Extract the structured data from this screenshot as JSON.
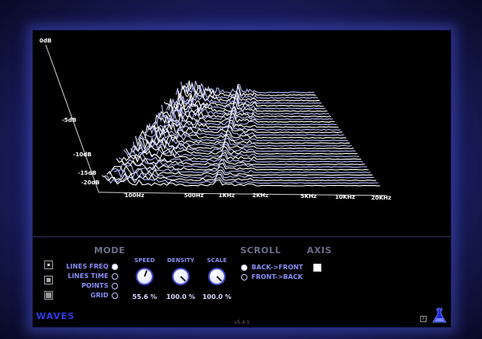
{
  "plot": {
    "y_labels": [
      "0dB",
      "-5dB",
      "-10dB",
      "-15dB",
      "-20dB"
    ],
    "x_labels": [
      "100Hz",
      "500Hz",
      "1KHz",
      "2KHz",
      "5KHz",
      "10KHz",
      "20KHz"
    ]
  },
  "mode": {
    "title": "MODE",
    "options": [
      "LINES FREQ",
      "LINES TIME",
      "POINTS",
      "GRID"
    ],
    "selected": "LINES FREQ"
  },
  "knobs": [
    {
      "title": "SPEED",
      "value": "55.6 %"
    },
    {
      "title": "DENSITY",
      "value": "100.0 %"
    },
    {
      "title": "SCALE",
      "value": "100.0 %"
    }
  ],
  "scroll": {
    "title": "SCROLL",
    "options": [
      "BACK->FRONT",
      "FRONT->BACK"
    ],
    "selected": "BACK->FRONT"
  },
  "axis": {
    "title": "AXIS",
    "checked": false
  },
  "footer": {
    "logo": "WAVES",
    "version": "v5.4.1",
    "help": "?"
  },
  "icons": [
    "square-view-icon",
    "help-icon",
    "flask-logo-icon"
  ],
  "colors": {
    "accent": "#8a8df2",
    "trace": "#ffffff",
    "logo": "#2a39e6"
  }
}
